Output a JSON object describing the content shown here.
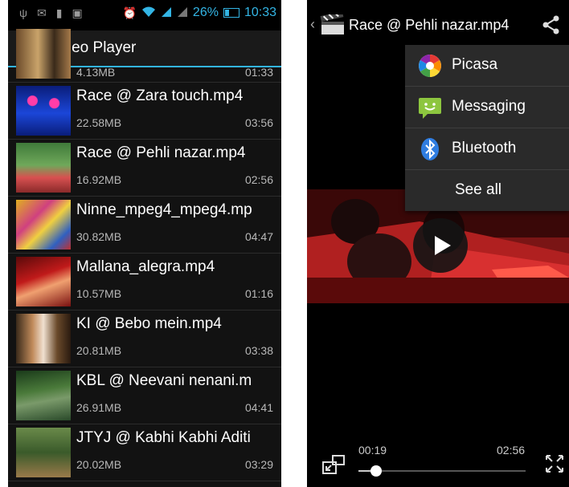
{
  "status_bar": {
    "battery_percent": "26%",
    "time": "10:33"
  },
  "app_bar": {
    "title": "Video Player"
  },
  "video_list": [
    {
      "name": "",
      "size": "4.13MB",
      "duration": "01:33"
    },
    {
      "name": "Race @ Zara touch.mp4",
      "size": "22.58MB",
      "duration": "03:56"
    },
    {
      "name": "Race @ Pehli nazar.mp4",
      "size": "16.92MB",
      "duration": "02:56"
    },
    {
      "name": "Ninne_mpeg4_mpeg4.mp",
      "size": "30.82MB",
      "duration": "04:47"
    },
    {
      "name": "Mallana_alegra.mp4",
      "size": "10.57MB",
      "duration": "01:16"
    },
    {
      "name": "KI @ Bebo mein.mp4",
      "size": "20.81MB",
      "duration": "03:38"
    },
    {
      "name": "KBL @ Neevani nenani.m",
      "size": "26.91MB",
      "duration": "04:41"
    },
    {
      "name": "JTYJ @ Kabhi Kabhi Aditi",
      "size": "20.02MB",
      "duration": "03:29"
    }
  ],
  "player": {
    "title": "Race @ Pehli nazar.mp4",
    "elapsed": "00:19",
    "total": "02:56",
    "progress": 0.108
  },
  "share_menu": {
    "items": [
      "Picasa",
      "Messaging",
      "Bluetooth"
    ],
    "see_all": "See all"
  },
  "colors": {
    "accent": "#33b5e5",
    "messaging_green": "#8dc63f",
    "bluetooth_blue": "#2f7de1"
  },
  "icons": {
    "app": "clapperboard-icon",
    "share": "share-icon",
    "pip": "picture-in-picture-icon",
    "fullscreen": "fullscreen-icon"
  }
}
